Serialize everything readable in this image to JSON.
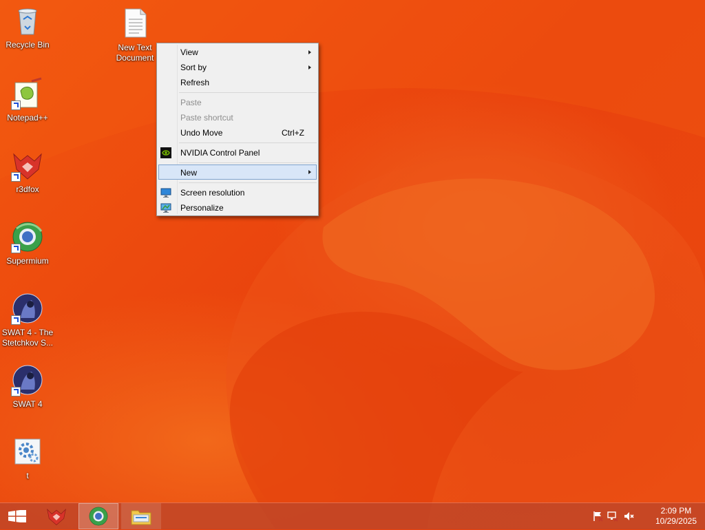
{
  "desktop": {
    "icons": [
      {
        "label": "Recycle Bin",
        "icon": "recycle-bin-icon"
      },
      {
        "label": "New Text Document",
        "icon": "text-document-icon"
      },
      {
        "label": "Notepad++",
        "icon": "notepad-plus-plus-icon"
      },
      {
        "label": "r3dfox",
        "icon": "r3dfox-icon"
      },
      {
        "label": "Supermium",
        "icon": "supermium-icon"
      },
      {
        "label": "SWAT 4 - The Stetchkov S...",
        "icon": "swat4-expansion-icon"
      },
      {
        "label": "SWAT 4",
        "icon": "swat4-icon"
      },
      {
        "label": "t",
        "icon": "settings-file-icon"
      }
    ]
  },
  "context_menu": {
    "items": {
      "view": "View",
      "sort_by": "Sort by",
      "refresh": "Refresh",
      "paste": "Paste",
      "paste_shortcut": "Paste shortcut",
      "undo_move": "Undo Move",
      "undo_move_shortcut": "Ctrl+Z",
      "nvidia": "NVIDIA Control Panel",
      "new": "New",
      "screen_resolution": "Screen resolution",
      "personalize": "Personalize"
    },
    "highlighted": "New"
  },
  "taskbar": {
    "pinned": [
      "start-button",
      "r3dfox",
      "supermium",
      "file-explorer"
    ],
    "active": "supermium",
    "clock": {
      "time": "2:09 PM",
      "date": "10/29/2025"
    }
  },
  "colors": {
    "wallpaper": "#e9420d",
    "menu_bg": "#f0f0f0",
    "menu_highlight": "#d8e6f8",
    "taskbar": "#be4628"
  }
}
